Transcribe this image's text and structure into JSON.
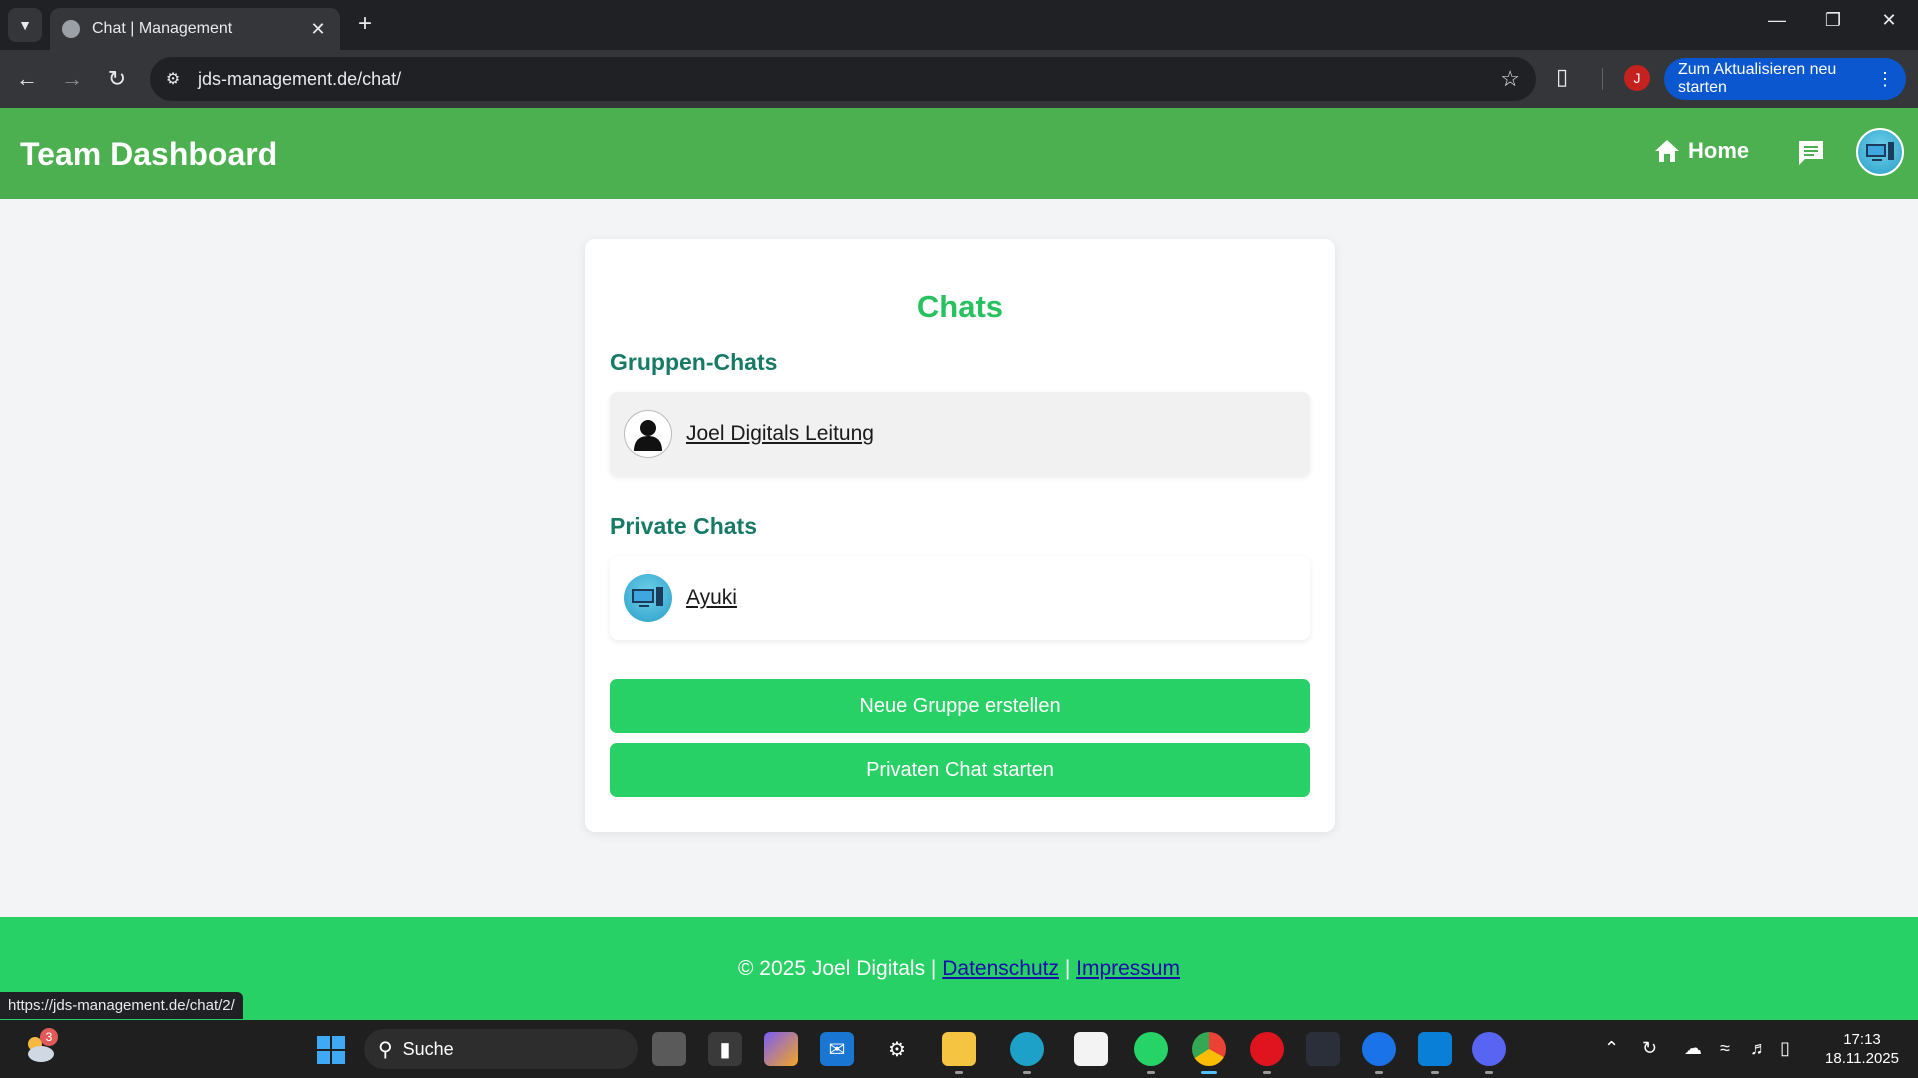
{
  "browser": {
    "tab_title": "Chat | Management",
    "url": "jds-management.de/chat/",
    "profile_initial": "J",
    "update_label": "Zum Aktualisieren neu starten",
    "status_url": "https://jds-management.de/chat/2/"
  },
  "header": {
    "brand": "Team Dashboard",
    "home_label": "Home"
  },
  "chats": {
    "title": "Chats",
    "group_section": "Gruppen-Chats",
    "groups": [
      {
        "name": "Joel Digitals Leitung",
        "avatar": "person-silhouette-icon"
      }
    ],
    "private_section": "Private Chats",
    "privates": [
      {
        "name": "Ayuki",
        "avatar": "computer-avatar-icon"
      }
    ],
    "new_group_label": "Neue Gruppe erstellen",
    "private_chat_label": "Privaten Chat starten"
  },
  "footer": {
    "copyright": "© 2025 Joel Digitals",
    "separator": "|",
    "privacy_label": "Datenschutz",
    "imprint_label": "Impressum"
  },
  "taskbar": {
    "weather_badge": "3",
    "search_label": "Suche",
    "time": "17:13",
    "date": "18.11.2025"
  },
  "colors": {
    "header_green": "#4caf50",
    "button_green": "#28d165",
    "title_green": "#28c15f",
    "section_teal": "#167a67"
  }
}
